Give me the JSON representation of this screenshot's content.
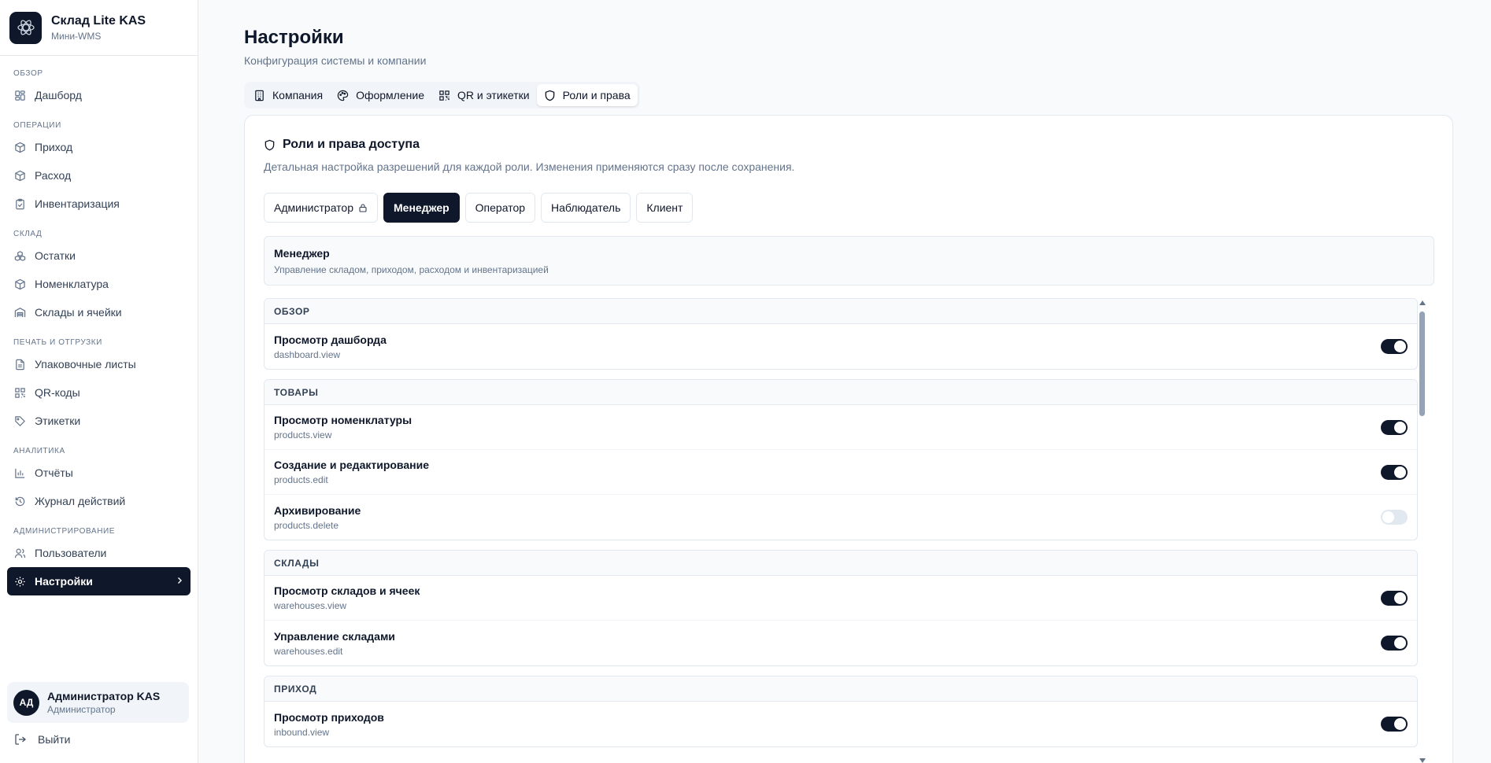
{
  "brand": {
    "title": "Склад Lite KAS",
    "subtitle": "Мини-WMS"
  },
  "nav": {
    "overview": "Обзор",
    "dashboard": "Дашборд",
    "operations": "Операции",
    "inbound": "Приход",
    "outbound": "Расход",
    "inventory": "Инвентаризация",
    "warehouse": "Склад",
    "stock": "Остатки",
    "products": "Номенклатура",
    "warehouses": "Склады и ячейки",
    "printing": "Печать и отгрузки",
    "packing": "Упаковочные листы",
    "qrcodes": "QR-коды",
    "labels": "Этикетки",
    "analytics": "Аналитика",
    "reports": "Отчёты",
    "journal": "Журнал действий",
    "admin": "Администрирование",
    "users": "Пользователи",
    "settings": "Настройки"
  },
  "user": {
    "initials": "АД",
    "name": "Администратор KAS",
    "role": "Администратор",
    "logout": "Выйти"
  },
  "page": {
    "title": "Настройки",
    "subtitle": "Конфигурация системы и компании"
  },
  "tabs": {
    "company": "Компания",
    "appearance": "Оформление",
    "qr": "QR и этикетки",
    "roles": "Роли и права"
  },
  "card": {
    "title": "Роли и права доступа",
    "subtitle": "Детальная настройка разрешений для каждой роли. Изменения применяются сразу после сохранения."
  },
  "roles": {
    "admin": "Администратор",
    "manager": "Менеджер",
    "operator": "Оператор",
    "observer": "Наблюдатель",
    "client": "Клиент"
  },
  "role_info": {
    "name": "Менеджер",
    "desc": "Управление складом, приходом, расходом и инвентаризацией"
  },
  "groups": {
    "overview": {
      "title": "Обзор",
      "p1": {
        "name": "Просмотр дашборда",
        "code": "dashboard.view",
        "enabled": true
      }
    },
    "products": {
      "title": "Товары",
      "p1": {
        "name": "Просмотр номенклатуры",
        "code": "products.view",
        "enabled": true
      },
      "p2": {
        "name": "Создание и редактирование",
        "code": "products.edit",
        "enabled": true
      },
      "p3": {
        "name": "Архивирование",
        "code": "products.delete",
        "enabled": false
      }
    },
    "warehouses": {
      "title": "Склады",
      "p1": {
        "name": "Просмотр складов и ячеек",
        "code": "warehouses.view",
        "enabled": true
      },
      "p2": {
        "name": "Управление складами",
        "code": "warehouses.edit",
        "enabled": true
      }
    },
    "inbound": {
      "title": "Приход",
      "p1": {
        "name": "Просмотр приходов",
        "code": "inbound.view",
        "enabled": true
      }
    }
  },
  "colors": {
    "primary": "#0f172a",
    "muted": "#64748b",
    "border": "#e2e8f0"
  }
}
